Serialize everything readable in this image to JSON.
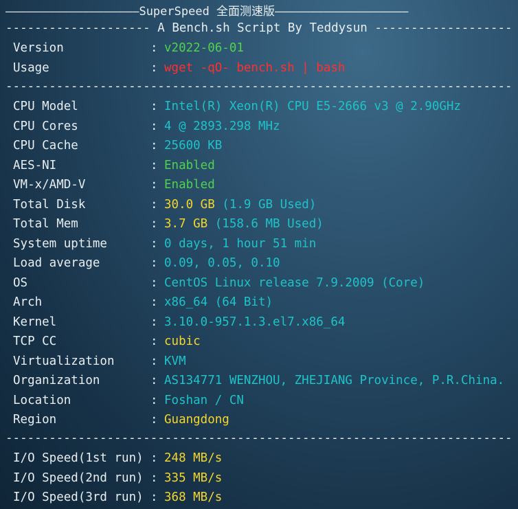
{
  "title_rule": "———————————————————SuperSpeed 全面测速版———————————————————",
  "header_rule": "-------------------- A Bench.sh Script By Teddysun -------------------",
  "separator": "----------------------------------------------------------------------",
  "colon": ":",
  "meta": [
    {
      "label": "Version",
      "value": "v2022-06-01",
      "color": "green"
    },
    {
      "label": "Usage",
      "value": "wget -qO- bench.sh | bash",
      "color": "red"
    }
  ],
  "system": [
    {
      "label": "CPU Model",
      "value": "Intel(R) Xeon(R) CPU E5-2666 v3 @ 2.90GHz",
      "color": "cyan"
    },
    {
      "label": "CPU Cores",
      "value": "4 @ 2893.298 MHz",
      "color": "cyan"
    },
    {
      "label": "CPU Cache",
      "value": "25600 KB",
      "color": "cyan"
    },
    {
      "label": "AES-NI",
      "value": "Enabled",
      "color": "green"
    },
    {
      "label": "VM-x/AMD-V",
      "value": "Enabled",
      "color": "green"
    },
    {
      "label": "Total Disk",
      "value_main": "30.0 GB",
      "value_extra": " (1.9 GB Used)",
      "color": "yellow"
    },
    {
      "label": "Total Mem",
      "value_main": "3.7 GB",
      "value_extra": " (158.6 MB Used)",
      "color": "yellow"
    },
    {
      "label": "System uptime",
      "value": "0 days, 1 hour 51 min",
      "color": "cyan"
    },
    {
      "label": "Load average",
      "value": "0.09, 0.05, 0.10",
      "color": "cyan"
    },
    {
      "label": "OS",
      "value": "CentOS Linux release 7.9.2009 (Core)",
      "color": "cyan"
    },
    {
      "label": "Arch",
      "value": "x86_64 (64 Bit)",
      "color": "cyan"
    },
    {
      "label": "Kernel",
      "value": "3.10.0-957.1.3.el7.x86_64",
      "color": "cyan"
    },
    {
      "label": "TCP CC",
      "value": "cubic",
      "color": "yellow"
    },
    {
      "label": "Virtualization",
      "value": "KVM",
      "color": "cyan"
    },
    {
      "label": "Organization",
      "value": "AS134771 WENZHOU, ZHEJIANG Province, P.R.China.",
      "color": "cyan"
    },
    {
      "label": "Location",
      "value": "Foshan / CN",
      "color": "cyan"
    },
    {
      "label": "Region",
      "value": "Guangdong",
      "color": "yellow"
    }
  ],
  "io": [
    {
      "label": "I/O Speed(1st run)",
      "value": "248 MB/s",
      "color": "yellow"
    },
    {
      "label": "I/O Speed(2nd run)",
      "value": "335 MB/s",
      "color": "yellow"
    },
    {
      "label": "I/O Speed(3rd run)",
      "value": "368 MB/s",
      "color": "yellow"
    }
  ]
}
